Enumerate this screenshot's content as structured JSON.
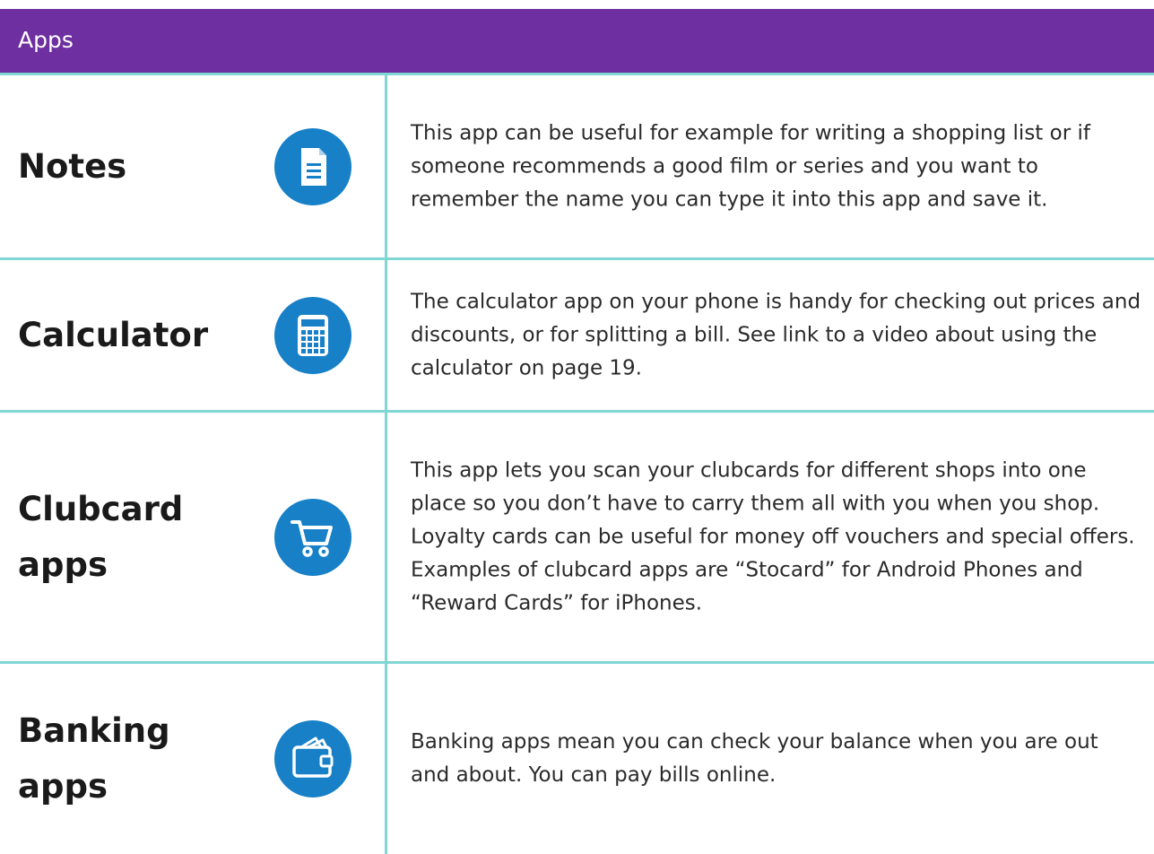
{
  "header": {
    "title": "Apps",
    "background_color": "#6e2fa0",
    "rule_color": "#7fd6d3"
  },
  "icon_color": "#1780c7",
  "apps": [
    {
      "name": "Notes",
      "icon": "notes-document-icon",
      "description": "This app can be useful for example for writing a shopping list or if someone recommends a good film or series and you want to remember the name you can type it into this app and save it."
    },
    {
      "name": "Calculator",
      "icon": "calculator-icon",
      "description": "The calculator app on your phone is handy for checking out prices and discounts, or for splitting a bill. See link to a video about using the calculator on page 19."
    },
    {
      "name": "Clubcard apps",
      "icon": "shopping-cart-icon",
      "description": "This app lets you scan your clubcards for different shops into one place so you don’t have to carry them all with you when you shop. Loyalty cards can be useful for money off vouchers and special offers. Examples of clubcard apps are “Stocard” for Android Phones and “Reward Cards” for iPhones."
    },
    {
      "name": "Banking apps",
      "icon": "wallet-icon",
      "description": "Banking apps mean you can check your balance when you are out and about. You can pay bills online."
    }
  ]
}
